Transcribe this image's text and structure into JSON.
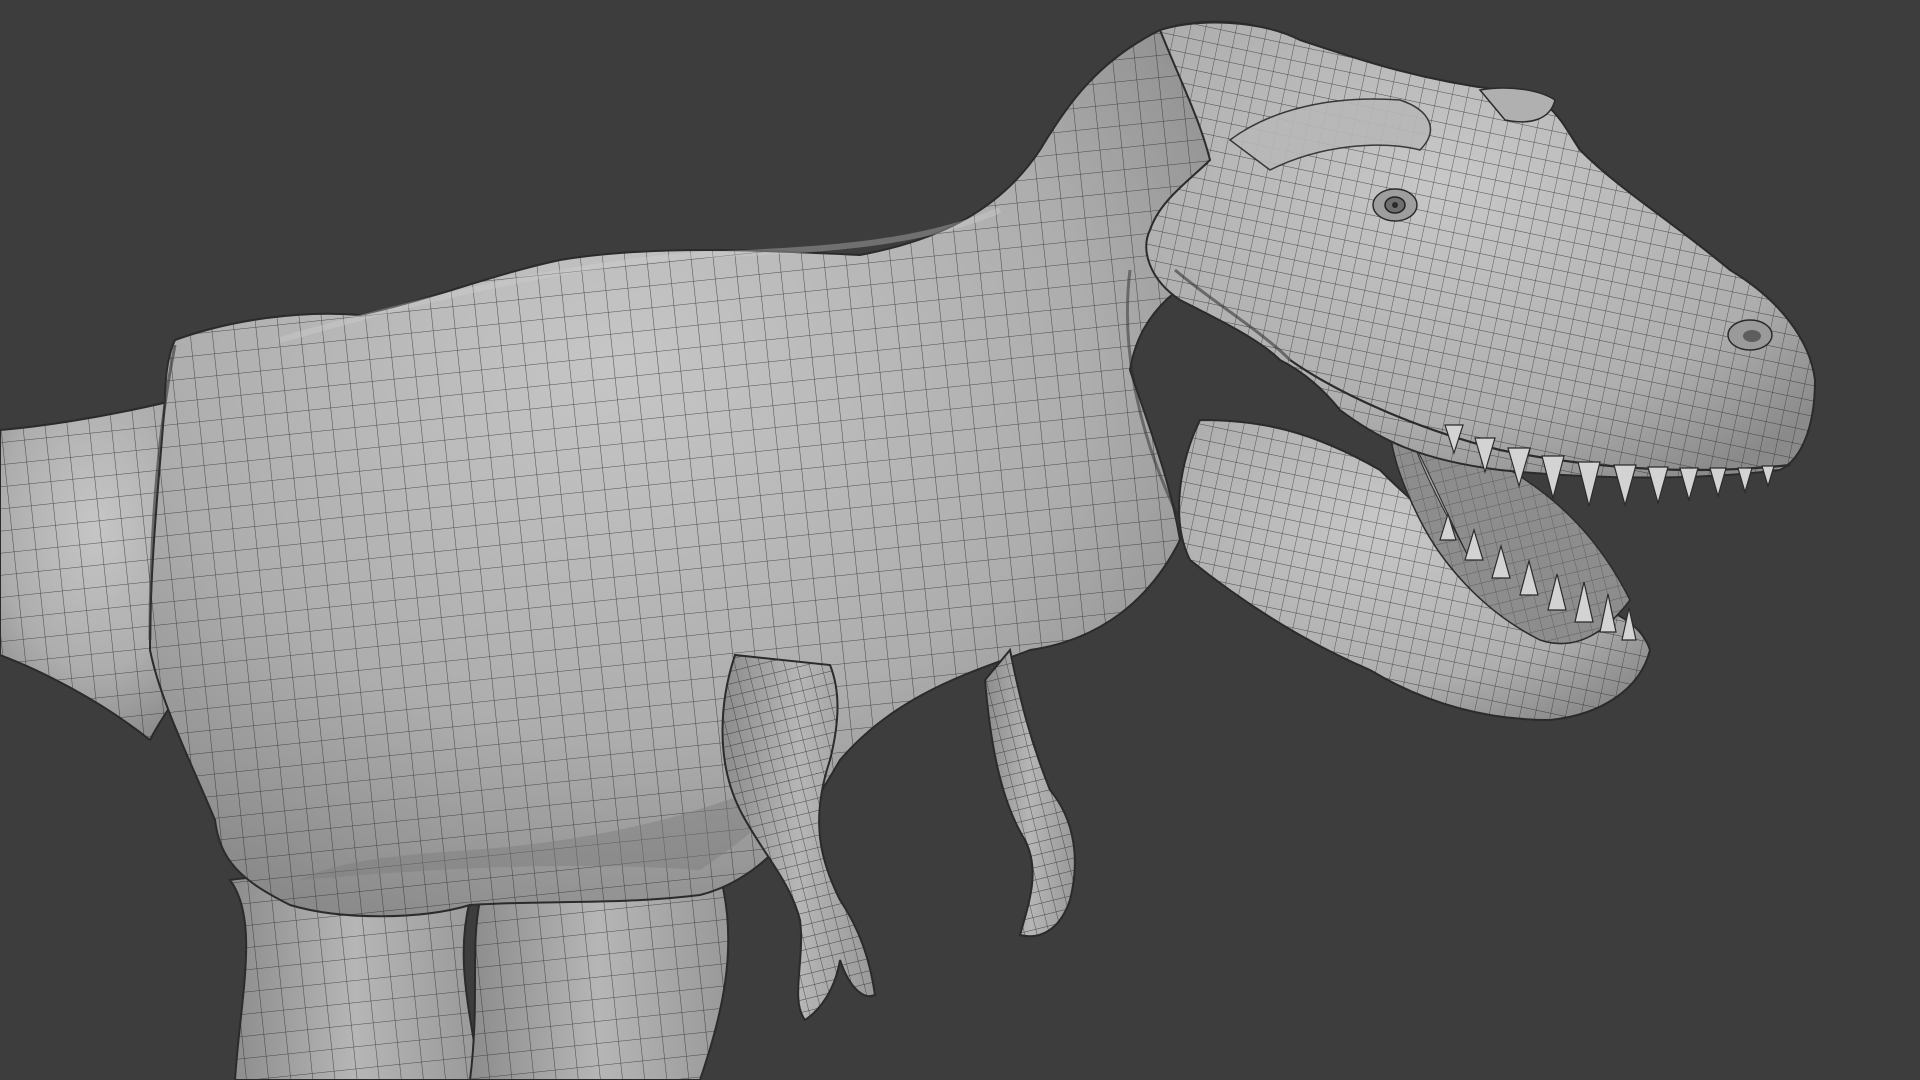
{
  "scene": {
    "subject": "tyrannosaurus-rex-mesh",
    "display_mode": "solid-with-wireframe",
    "colors": {
      "background": "#3d3d3d",
      "mesh_fill": "#ababab",
      "mesh_light": "#c4c4c4",
      "mesh_shadow": "#7e7e7e",
      "wire": "#2b2b2b",
      "mouth_interior": "#8d8d8d",
      "teeth": "#d3d3d3"
    }
  }
}
